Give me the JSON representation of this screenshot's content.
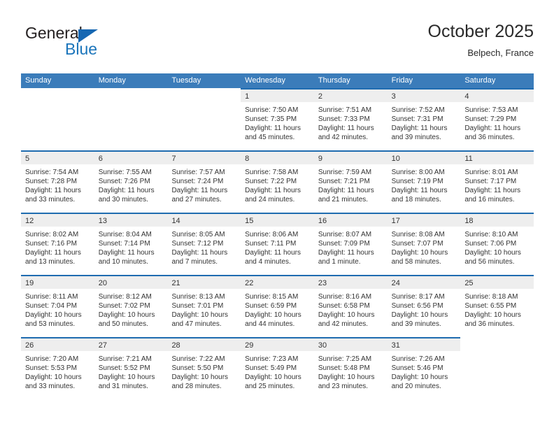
{
  "brand": {
    "name_part1": "General",
    "name_part2": "Blue",
    "triangle_icon": "triangle-icon",
    "accent_color": "#1b75bb"
  },
  "header": {
    "title": "October 2025",
    "subtitle": "Belpech, France"
  },
  "theme": {
    "header_row_bg": "#3b7cba",
    "week_top_border": "#1f6cb0",
    "day_band_bg": "#eeeeee",
    "text_color": "#333333"
  },
  "calendar": {
    "weekdays": [
      "Sunday",
      "Monday",
      "Tuesday",
      "Wednesday",
      "Thursday",
      "Friday",
      "Saturday"
    ],
    "weeks": [
      [
        {
          "day": "",
          "empty": true
        },
        {
          "day": "",
          "empty": true
        },
        {
          "day": "",
          "empty": true
        },
        {
          "day": "1",
          "sunrise": "Sunrise: 7:50 AM",
          "sunset": "Sunset: 7:35 PM",
          "daylight1": "Daylight: 11 hours",
          "daylight2": "and 45 minutes."
        },
        {
          "day": "2",
          "sunrise": "Sunrise: 7:51 AM",
          "sunset": "Sunset: 7:33 PM",
          "daylight1": "Daylight: 11 hours",
          "daylight2": "and 42 minutes."
        },
        {
          "day": "3",
          "sunrise": "Sunrise: 7:52 AM",
          "sunset": "Sunset: 7:31 PM",
          "daylight1": "Daylight: 11 hours",
          "daylight2": "and 39 minutes."
        },
        {
          "day": "4",
          "sunrise": "Sunrise: 7:53 AM",
          "sunset": "Sunset: 7:29 PM",
          "daylight1": "Daylight: 11 hours",
          "daylight2": "and 36 minutes."
        }
      ],
      [
        {
          "day": "5",
          "sunrise": "Sunrise: 7:54 AM",
          "sunset": "Sunset: 7:28 PM",
          "daylight1": "Daylight: 11 hours",
          "daylight2": "and 33 minutes."
        },
        {
          "day": "6",
          "sunrise": "Sunrise: 7:55 AM",
          "sunset": "Sunset: 7:26 PM",
          "daylight1": "Daylight: 11 hours",
          "daylight2": "and 30 minutes."
        },
        {
          "day": "7",
          "sunrise": "Sunrise: 7:57 AM",
          "sunset": "Sunset: 7:24 PM",
          "daylight1": "Daylight: 11 hours",
          "daylight2": "and 27 minutes."
        },
        {
          "day": "8",
          "sunrise": "Sunrise: 7:58 AM",
          "sunset": "Sunset: 7:22 PM",
          "daylight1": "Daylight: 11 hours",
          "daylight2": "and 24 minutes."
        },
        {
          "day": "9",
          "sunrise": "Sunrise: 7:59 AM",
          "sunset": "Sunset: 7:21 PM",
          "daylight1": "Daylight: 11 hours",
          "daylight2": "and 21 minutes."
        },
        {
          "day": "10",
          "sunrise": "Sunrise: 8:00 AM",
          "sunset": "Sunset: 7:19 PM",
          "daylight1": "Daylight: 11 hours",
          "daylight2": "and 18 minutes."
        },
        {
          "day": "11",
          "sunrise": "Sunrise: 8:01 AM",
          "sunset": "Sunset: 7:17 PM",
          "daylight1": "Daylight: 11 hours",
          "daylight2": "and 16 minutes."
        }
      ],
      [
        {
          "day": "12",
          "sunrise": "Sunrise: 8:02 AM",
          "sunset": "Sunset: 7:16 PM",
          "daylight1": "Daylight: 11 hours",
          "daylight2": "and 13 minutes."
        },
        {
          "day": "13",
          "sunrise": "Sunrise: 8:04 AM",
          "sunset": "Sunset: 7:14 PM",
          "daylight1": "Daylight: 11 hours",
          "daylight2": "and 10 minutes."
        },
        {
          "day": "14",
          "sunrise": "Sunrise: 8:05 AM",
          "sunset": "Sunset: 7:12 PM",
          "daylight1": "Daylight: 11 hours",
          "daylight2": "and 7 minutes."
        },
        {
          "day": "15",
          "sunrise": "Sunrise: 8:06 AM",
          "sunset": "Sunset: 7:11 PM",
          "daylight1": "Daylight: 11 hours",
          "daylight2": "and 4 minutes."
        },
        {
          "day": "16",
          "sunrise": "Sunrise: 8:07 AM",
          "sunset": "Sunset: 7:09 PM",
          "daylight1": "Daylight: 11 hours",
          "daylight2": "and 1 minute."
        },
        {
          "day": "17",
          "sunrise": "Sunrise: 8:08 AM",
          "sunset": "Sunset: 7:07 PM",
          "daylight1": "Daylight: 10 hours",
          "daylight2": "and 58 minutes."
        },
        {
          "day": "18",
          "sunrise": "Sunrise: 8:10 AM",
          "sunset": "Sunset: 7:06 PM",
          "daylight1": "Daylight: 10 hours",
          "daylight2": "and 56 minutes."
        }
      ],
      [
        {
          "day": "19",
          "sunrise": "Sunrise: 8:11 AM",
          "sunset": "Sunset: 7:04 PM",
          "daylight1": "Daylight: 10 hours",
          "daylight2": "and 53 minutes."
        },
        {
          "day": "20",
          "sunrise": "Sunrise: 8:12 AM",
          "sunset": "Sunset: 7:02 PM",
          "daylight1": "Daylight: 10 hours",
          "daylight2": "and 50 minutes."
        },
        {
          "day": "21",
          "sunrise": "Sunrise: 8:13 AM",
          "sunset": "Sunset: 7:01 PM",
          "daylight1": "Daylight: 10 hours",
          "daylight2": "and 47 minutes."
        },
        {
          "day": "22",
          "sunrise": "Sunrise: 8:15 AM",
          "sunset": "Sunset: 6:59 PM",
          "daylight1": "Daylight: 10 hours",
          "daylight2": "and 44 minutes."
        },
        {
          "day": "23",
          "sunrise": "Sunrise: 8:16 AM",
          "sunset": "Sunset: 6:58 PM",
          "daylight1": "Daylight: 10 hours",
          "daylight2": "and 42 minutes."
        },
        {
          "day": "24",
          "sunrise": "Sunrise: 8:17 AM",
          "sunset": "Sunset: 6:56 PM",
          "daylight1": "Daylight: 10 hours",
          "daylight2": "and 39 minutes."
        },
        {
          "day": "25",
          "sunrise": "Sunrise: 8:18 AM",
          "sunset": "Sunset: 6:55 PM",
          "daylight1": "Daylight: 10 hours",
          "daylight2": "and 36 minutes."
        }
      ],
      [
        {
          "day": "26",
          "sunrise": "Sunrise: 7:20 AM",
          "sunset": "Sunset: 5:53 PM",
          "daylight1": "Daylight: 10 hours",
          "daylight2": "and 33 minutes."
        },
        {
          "day": "27",
          "sunrise": "Sunrise: 7:21 AM",
          "sunset": "Sunset: 5:52 PM",
          "daylight1": "Daylight: 10 hours",
          "daylight2": "and 31 minutes."
        },
        {
          "day": "28",
          "sunrise": "Sunrise: 7:22 AM",
          "sunset": "Sunset: 5:50 PM",
          "daylight1": "Daylight: 10 hours",
          "daylight2": "and 28 minutes."
        },
        {
          "day": "29",
          "sunrise": "Sunrise: 7:23 AM",
          "sunset": "Sunset: 5:49 PM",
          "daylight1": "Daylight: 10 hours",
          "daylight2": "and 25 minutes."
        },
        {
          "day": "30",
          "sunrise": "Sunrise: 7:25 AM",
          "sunset": "Sunset: 5:48 PM",
          "daylight1": "Daylight: 10 hours",
          "daylight2": "and 23 minutes."
        },
        {
          "day": "31",
          "sunrise": "Sunrise: 7:26 AM",
          "sunset": "Sunset: 5:46 PM",
          "daylight1": "Daylight: 10 hours",
          "daylight2": "and 20 minutes."
        },
        {
          "day": "",
          "empty": true
        }
      ]
    ]
  }
}
